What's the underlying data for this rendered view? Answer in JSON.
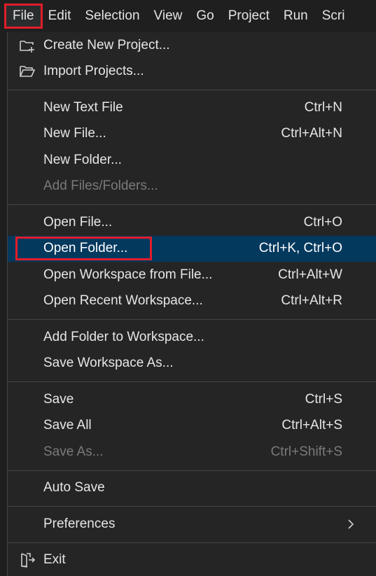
{
  "menubar": {
    "items": [
      {
        "label": "File"
      },
      {
        "label": "Edit"
      },
      {
        "label": "Selection"
      },
      {
        "label": "View"
      },
      {
        "label": "Go"
      },
      {
        "label": "Project"
      },
      {
        "label": "Run"
      },
      {
        "label": "Scri"
      }
    ]
  },
  "menu": {
    "group1": [
      {
        "label": "Create New Project...",
        "icon": "new-project-icon"
      },
      {
        "label": "Import Projects...",
        "icon": "folder-open-icon"
      }
    ],
    "group2": [
      {
        "label": "New Text File",
        "shortcut": "Ctrl+N"
      },
      {
        "label": "New File...",
        "shortcut": "Ctrl+Alt+N"
      },
      {
        "label": "New Folder...",
        "shortcut": ""
      },
      {
        "label": "Add Files/Folders...",
        "shortcut": "",
        "disabled": true
      }
    ],
    "group3": [
      {
        "label": "Open File...",
        "shortcut": "Ctrl+O"
      },
      {
        "label": "Open Folder...",
        "shortcut": "Ctrl+K, Ctrl+O",
        "highlighted": true
      },
      {
        "label": "Open Workspace from File...",
        "shortcut": "Ctrl+Alt+W"
      },
      {
        "label": "Open Recent Workspace...",
        "shortcut": "Ctrl+Alt+R"
      }
    ],
    "group4": [
      {
        "label": "Add Folder to Workspace..."
      },
      {
        "label": "Save Workspace As..."
      }
    ],
    "group5": [
      {
        "label": "Save",
        "shortcut": "Ctrl+S"
      },
      {
        "label": "Save All",
        "shortcut": "Ctrl+Alt+S"
      },
      {
        "label": "Save As...",
        "shortcut": "Ctrl+Shift+S",
        "disabled": true
      }
    ],
    "group6": [
      {
        "label": "Auto Save"
      }
    ],
    "group7": [
      {
        "label": "Preferences",
        "icon": "chevron-right-icon"
      }
    ],
    "group8": [
      {
        "label": "Exit",
        "icon": "exit-icon"
      }
    ]
  },
  "colors": {
    "background": "#1e1e1e",
    "menu_background": "#252526",
    "highlight": "#04395e",
    "annotation_box": "#e11d2a",
    "disabled_text": "#7a7a7a"
  }
}
